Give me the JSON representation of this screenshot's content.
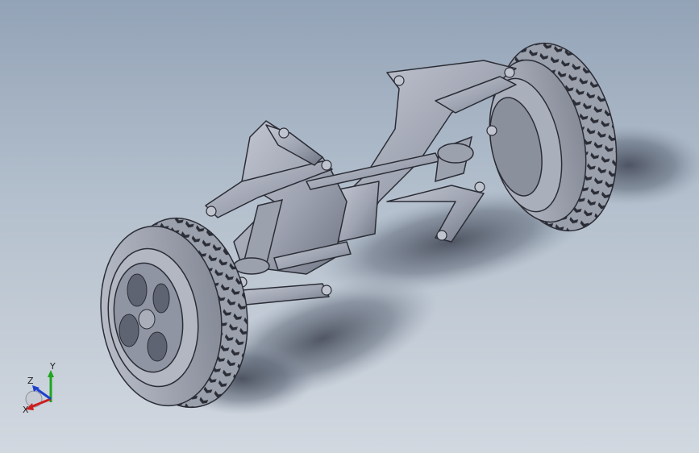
{
  "viewport": {
    "background_top": "#93a3b7",
    "background_bottom": "#d2d8e0",
    "model_color": "#a7acba",
    "edge_color": "#2b2d36"
  },
  "model": {
    "name": "suspension-assembly",
    "components": [
      "left-wheel",
      "right-wheel",
      "chassis-frame",
      "upper-control-arms",
      "lower-control-arms",
      "shock-absorbers",
      "tie-rod"
    ]
  },
  "triad": {
    "x_label": "X",
    "y_label": "Y",
    "z_label": "Z",
    "x_color": "#cc1f1f",
    "y_color": "#1fa51f",
    "z_color": "#1f3fcc"
  }
}
